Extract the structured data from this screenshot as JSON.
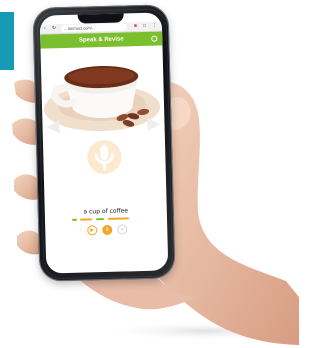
{
  "browser": {
    "url": "…lanmoct.com/…",
    "back_icon": "chevron-left-icon",
    "refresh_icon": "refresh-icon",
    "menu_icon": "more-options-icon"
  },
  "app": {
    "title": "Speak & Revise",
    "header_color": "#7cbf2e",
    "accent_color": "#f1a826"
  },
  "lesson": {
    "phrase": "a cup of coffee",
    "word_status_colors": [
      "#7cbf2e",
      "#f1a826",
      "#7cbf2e",
      "#f1a826"
    ],
    "controls": [
      {
        "icon": "play-icon",
        "symbol": "▶"
      },
      {
        "icon": "pause-icon",
        "symbol": "Ⅱ"
      },
      {
        "icon": "record-icon",
        "symbol": "●"
      }
    ]
  },
  "background": {
    "accent_strip_color": "#159ab7"
  }
}
